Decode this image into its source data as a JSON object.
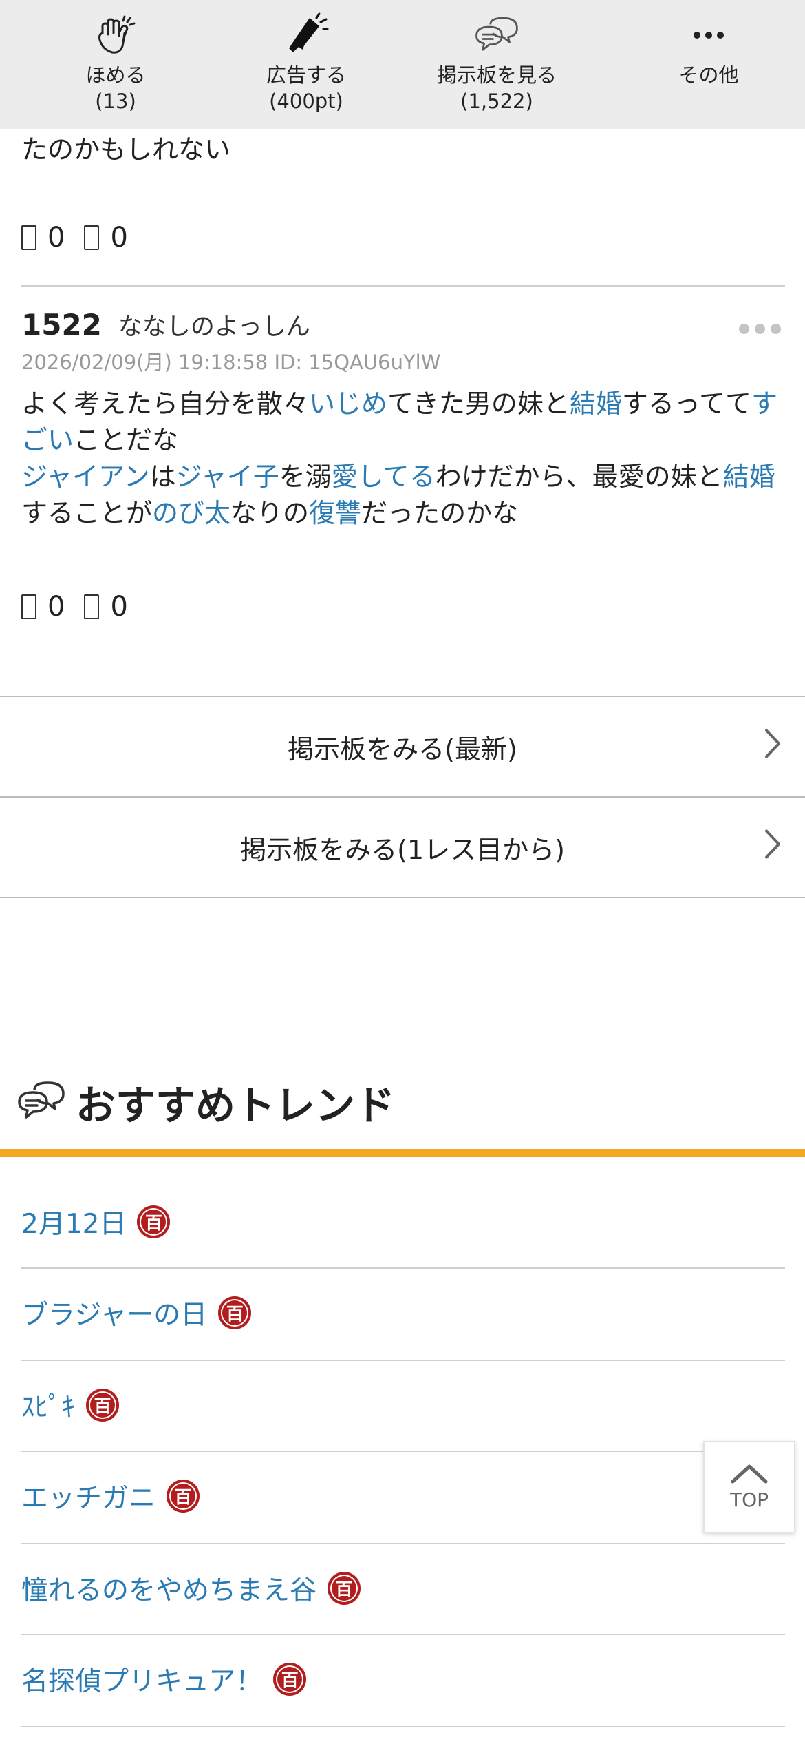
{
  "actions": [
    {
      "icon": "clapping-hands-icon",
      "label": "ほめる",
      "count": "(13)"
    },
    {
      "icon": "megaphone-icon",
      "label": "広告する",
      "count": "(400pt)"
    },
    {
      "icon": "chat-bubbles-icon",
      "label": "掲示板を見る",
      "count": "(1,522)"
    },
    {
      "icon": "more-dots-icon",
      "label": "その他",
      "count": ""
    }
  ],
  "previous_post": {
    "text_fragment": "たのかもしれない",
    "good_count": "0",
    "bad_count": "0"
  },
  "post": {
    "number": "1522",
    "author": "ななしのよっしん",
    "meta": "2026/02/09(月) 19:18:58 ID: 15QAU6uYlW",
    "body": {
      "s1": "よく考えたら自分を散々",
      "k1": "いじめ",
      "s2": "てきた男の妹と",
      "k2": "結婚",
      "s3": "するってて",
      "k3": "すごい",
      "s4": "ことだな",
      "k4": "ジャイアン",
      "s5": "は",
      "k5": "ジャイ子",
      "s6": "を溺",
      "k6": "愛してる",
      "s7": "わけだから、最愛の妹と",
      "k7": "結婚",
      "s8": "することが",
      "k8": "のび太",
      "s9": "なりの",
      "k9": "復讐",
      "s10": "だったのかな"
    },
    "good_count": "0",
    "bad_count": "0"
  },
  "board_links": {
    "latest": "掲示板をみる(最新)",
    "from_first": "掲示板をみる(1レス目から)"
  },
  "trend": {
    "title": "おすすめトレンド",
    "badge": "百",
    "items": [
      "2月12日",
      "ブラジャーの日",
      "ｽﾋﾟｷ",
      "エッチガニ",
      "憧れるのをやめちまえ谷",
      "名探偵プリキュア！"
    ]
  },
  "top_button": {
    "label": "TOP"
  },
  "colors": {
    "link": "#2a7ab3",
    "accent_bar": "#f5a71f",
    "badge": "#b41d1d",
    "action_bar_bg": "#ececec"
  }
}
